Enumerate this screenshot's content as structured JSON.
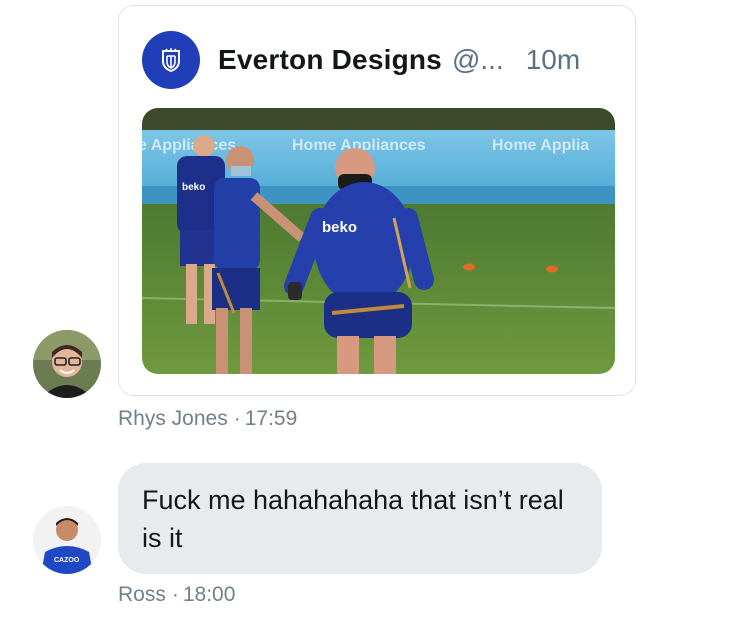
{
  "shared_tweet": {
    "author_name": "Everton Designs",
    "author_handle": "@...",
    "time_ago": "10m",
    "image_description_icon": "photo",
    "image_text": {
      "banner_left": "e Appliances",
      "banner_mid": "Home Appliances",
      "banner_right": "Home Applia",
      "shirt_sponsor": "beko"
    }
  },
  "messages": [
    {
      "sender": "Rhys Jones",
      "separator": "·",
      "time": "17:59",
      "type": "shared_tweet"
    },
    {
      "sender": "Ross",
      "separator": "·",
      "time": "18:00",
      "text": "Fuck me hahahahaha  that isn’t real is it",
      "avatar_shirt_text": "CAZOO"
    }
  ],
  "colors": {
    "everton_blue": "#1f3eb8",
    "bubble_gray": "#e8ebee",
    "meta_gray": "#71808d"
  }
}
